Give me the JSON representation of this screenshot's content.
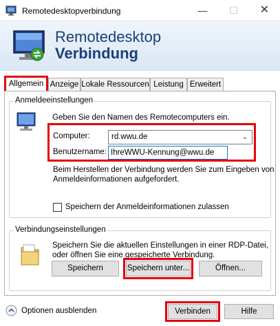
{
  "window": {
    "title": "Remotedesktopverbindung",
    "icon": "remote-desktop-icon",
    "controls": {
      "minimize": "—",
      "maximize": "☐",
      "close": "✕"
    }
  },
  "banner": {
    "line1": "Remotedesktop",
    "line2": "Verbindung",
    "icon": "monitor-connection-icon"
  },
  "tabs": [
    {
      "label": "Allgemein",
      "active": true
    },
    {
      "label": "Anzeige",
      "active": false
    },
    {
      "label": "Lokale Ressourcen",
      "active": false
    },
    {
      "label": "Leistung",
      "active": false
    },
    {
      "label": "Erweitert",
      "active": false
    }
  ],
  "logon": {
    "group_title": "Anmeldeeinstellungen",
    "instruction": "Geben Sie den Namen des Remotecomputers ein.",
    "computer_label": "Computer:",
    "computer_value": "rd.wwu.de",
    "username_label": "Benutzername:",
    "username_value": "IhreWWU-Kennung@wwu.de",
    "prompt_line1": "Beim Herstellen der Verbindung werden Sie zum Eingeben von",
    "prompt_line2": "Anmeldeinformationen aufgefordert.",
    "save_credentials_label": "Speichern der Anmeldeinformationen zulassen",
    "save_credentials_checked": false
  },
  "connection": {
    "group_title": "Verbindungseinstellungen",
    "desc_line1": "Speichern Sie die aktuellen Einstellungen in einer RDP-Datei,",
    "desc_line2": "oder öffnen Sie eine gespeicherte Verbindung.",
    "save_label": "Speichern",
    "save_as_label": "Speichern unter...",
    "open_label": "Öffnen..."
  },
  "footer": {
    "hide_options_label": "Optionen ausblenden",
    "connect_label": "Verbinden",
    "help_label": "Hilfe"
  },
  "colors": {
    "highlight": "#e3000b",
    "banner_text": "#1c3f7a"
  }
}
